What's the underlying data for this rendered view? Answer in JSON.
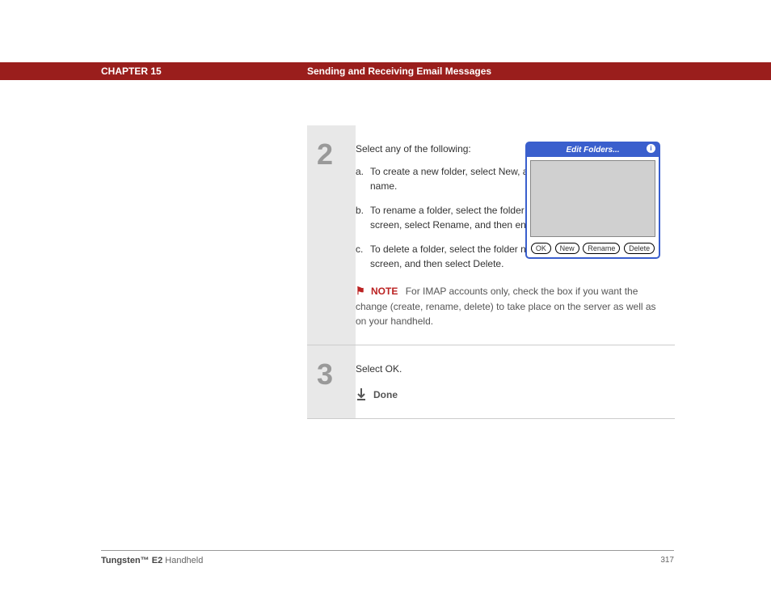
{
  "header": {
    "chapter": "CHAPTER 15",
    "title": "Sending and Receiving Email Messages"
  },
  "steps": [
    {
      "num": "2",
      "intro": "Select any of the following:",
      "items": [
        {
          "letter": "a.",
          "text": "To create a new folder, select New, and then enter the new folder name.",
          "narrow": true
        },
        {
          "letter": "b.",
          "text": "To rename a folder, select the folder name from the list on the screen, select Rename, and then enter the new folder name.",
          "narrow": true
        },
        {
          "letter": "c.",
          "text": "To delete a folder, select the folder name from the list on the screen, and then select Delete.",
          "narrow": false
        }
      ],
      "note": {
        "label": "NOTE",
        "text": "For IMAP accounts only, check the box if you want the change (create, rename, delete) to take place on the server as well as on your handheld."
      }
    },
    {
      "num": "3",
      "text": "Select OK.",
      "done": "Done"
    }
  ],
  "dialog": {
    "title": "Edit Folders...",
    "info": "i",
    "buttons": [
      "OK",
      "New",
      "Rename",
      "Delete"
    ]
  },
  "footer": {
    "brand_bold": "Tungsten™ E2",
    "brand_rest": " Handheld",
    "page": "317"
  }
}
